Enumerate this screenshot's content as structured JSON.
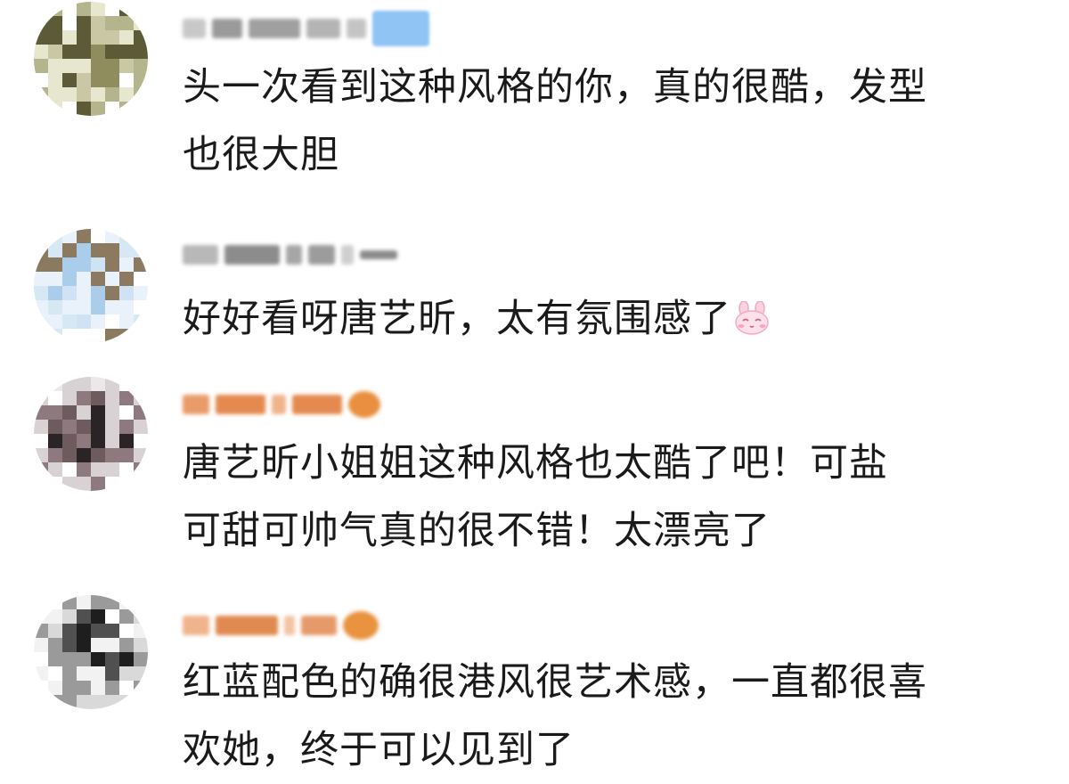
{
  "comments": [
    {
      "username_masked": "",
      "text_lines": [
        "头一次看到这种风格的你，真的很酷，发型",
        "也很大胆"
      ],
      "avatar_palette": [
        "#c9c7a4",
        "#8f8c5e",
        "#e7e6cf",
        "#5d5b37",
        "#b4b48d",
        "#ffffff"
      ]
    },
    {
      "username_masked": "",
      "text_lines": [
        "好好看呀唐艺昕，太有氛围感了"
      ],
      "avatar_palette": [
        "#cfe3f5",
        "#a9cdea",
        "#e9f2fa",
        "#8b7a5f",
        "#d7e8f5",
        "#ffffff"
      ]
    },
    {
      "username_masked": "",
      "text_lines": [
        "唐艺昕小姐姐这种风格也太酷了吧！可盐",
        "可甜可帅气真的很不错！太漂亮了"
      ],
      "avatar_palette": [
        "#2b2426",
        "#6d5b5e",
        "#d9d2d5",
        "#8e7a7e",
        "#ece8ea",
        "#ffffff"
      ]
    },
    {
      "username_masked": "",
      "text_lines": [
        "红蓝配色的确很港风很艺术感，一直都很喜",
        "欢她，终于可以见到了"
      ],
      "avatar_palette": [
        "#1e1e1e",
        "#505050",
        "#f2f2f2",
        "#9a9a9a",
        "#d9d9d9",
        "#ffffff"
      ]
    }
  ],
  "icons": {
    "verified_badge": "vip-badge-icon",
    "bunny_emoji": "bunny-emoji-icon"
  },
  "colors": {
    "text": "#1a1a1a",
    "badge": "#8fc4f4",
    "name_orange": "#e8813a",
    "name_gray": "#8a8a8a"
  }
}
